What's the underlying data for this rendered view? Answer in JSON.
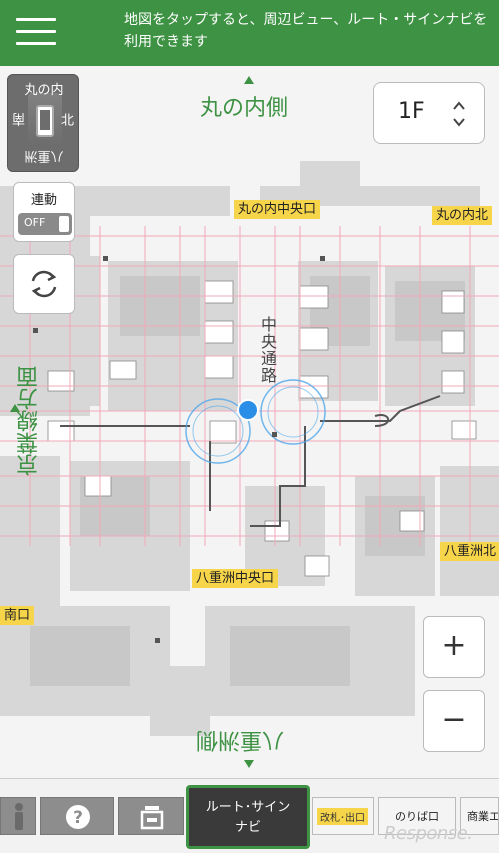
{
  "header": {
    "menu_icon": "hamburger-icon",
    "message": "地図をタップすると、周辺ビュー、ルート・サインナビを利用できます"
  },
  "map": {
    "direction_top": "丸の内側",
    "direction_bottom": "八重洲側",
    "direction_left": "京葉線方面",
    "street": "中央通路",
    "exits": {
      "marunouchi_central": "丸の内中央口",
      "marunouchi_north": "丸の内北",
      "yaesu_central": "八重洲中央口",
      "yaesu_north": "八重洲北",
      "south": "南口"
    }
  },
  "compass": {
    "top": "丸の内",
    "left": "南",
    "right": "北",
    "bottom": "八重洲"
  },
  "sync": {
    "label": "連動",
    "state": "OFF"
  },
  "floor": {
    "selected": "1F"
  },
  "zoom": {
    "in": "+",
    "out": "−"
  },
  "toolbar": {
    "route_line1": "ルート･サイン",
    "route_line2": "ナビ",
    "gate": "改札･出口",
    "bus": "のりば口",
    "shop": "商業エ"
  },
  "colors": {
    "brand_green": "#3e9244",
    "exit_yellow": "#f7d54a",
    "location_blue": "#2b8fe8"
  }
}
